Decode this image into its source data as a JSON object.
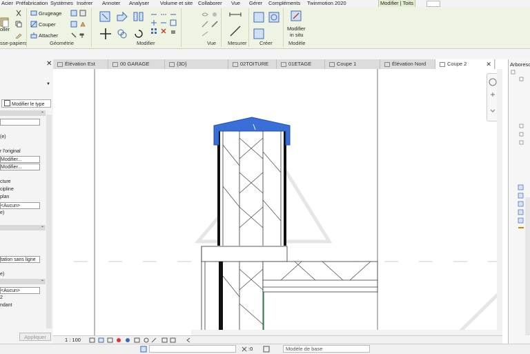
{
  "menu": [
    {
      "label": "Acier"
    },
    {
      "label": "Préfabrication"
    },
    {
      "label": "Systèmes"
    },
    {
      "label": "Insérer"
    },
    {
      "label": "Annoter"
    },
    {
      "label": "Analyser"
    },
    {
      "label": "Volume et site"
    },
    {
      "label": "Collaborer"
    },
    {
      "label": "Vue"
    },
    {
      "label": "Gérer"
    },
    {
      "label": "Compléments"
    },
    {
      "label": "Twinmotion 2020"
    },
    {
      "label": "Modifier | Toits"
    }
  ],
  "ribbon": {
    "clipboard_label": "sse-papiers",
    "paste_label": "oller",
    "geometry_label": "Géométrie",
    "gruge": "Grugeage",
    "couper": "Couper",
    "attacher": "Attacher",
    "modify_label": "Modifier",
    "view_label": "Vue",
    "measure_label": "Mesurer",
    "create_label": "Créer",
    "model_label": "Modèle",
    "inplace_line1": "Modifier",
    "inplace_line2": "in situ"
  },
  "properties": {
    "type_button": "Modifier le type",
    "rows": [
      {
        "text": "(e)",
        "box": false
      },
      {
        "text": "r l'original",
        "box": false
      },
      {
        "text": "Modifier...",
        "box": true
      },
      {
        "text": "Modifier...",
        "box": true
      },
      {
        "text": "cture",
        "box": false
      },
      {
        "text": "cipline",
        "box": false
      },
      {
        "text": "plan",
        "box": false
      },
      {
        "text": "<Aucun>",
        "box": true
      },
      {
        "text": "e)",
        "box": false
      },
      {
        "text": "tation sans ligne",
        "box": true
      },
      {
        "text": "e)",
        "box": false
      },
      {
        "text": "<Aucun>",
        "box": true
      },
      {
        "text": "2",
        "box": false
      },
      {
        "text": "ndant",
        "box": false
      }
    ],
    "apply_button": "Appliquer"
  },
  "tabs": [
    {
      "label": "Élévation Est"
    },
    {
      "label": "00 GARAGE"
    },
    {
      "label": "{3D}"
    },
    {
      "label": "02TOITURE"
    },
    {
      "label": "01ETAGE"
    },
    {
      "label": "Coupe 1"
    },
    {
      "label": "Élévation Nord"
    },
    {
      "label": "Coupe 2"
    }
  ],
  "viewbar": {
    "scale": "1 : 100"
  },
  "statusbar": {
    "sync": ":0",
    "model": "Modèle de base"
  },
  "browser": {
    "title": "Arboresc"
  },
  "colors": {
    "ribbon": "#eef3e3",
    "selection": "#3a6fd8",
    "active_tab": "#ffffff"
  }
}
